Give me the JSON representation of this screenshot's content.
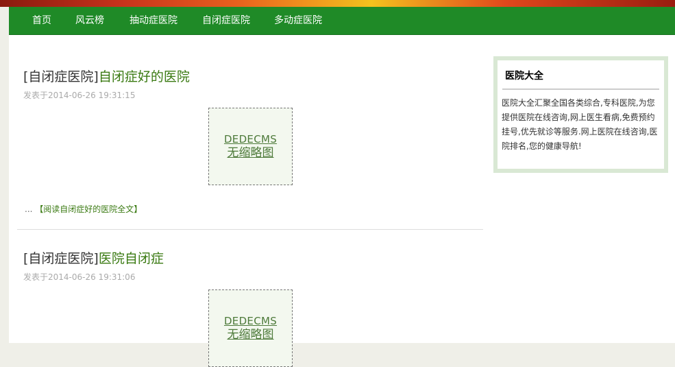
{
  "nav": {
    "items": [
      "首页",
      "风云榜",
      "抽动症医院",
      "自闭症医院",
      "多动症医院"
    ]
  },
  "articles": [
    {
      "category": "[自闭症医院]",
      "title": "自闭症好的医院",
      "meta": "发表于2014-06-26 19:31:15",
      "thumb_line1": "DEDECMS",
      "thumb_line2": "无缩略图",
      "ellipsis": "...",
      "read_more": "【阅读自闭症好的医院全文】"
    },
    {
      "category": "[自闭症医院]",
      "title": "医院自闭症",
      "meta": "发表于2014-06-26 19:31:06",
      "thumb_line1": "DEDECMS",
      "thumb_line2": "无缩略图"
    }
  ],
  "sidebar": {
    "title": "医院大全",
    "description": "医院大全汇聚全国各类综合,专科医院,为您提供医院在线咨询,网上医生看病,免费预约挂号,优先就诊等服务.网上医院在线咨询,医院排名,您的健康导航!"
  },
  "colors": {
    "nav_bg": "#1f8a27",
    "link_green": "#3a7a12",
    "sidebar_border": "#d9e8d4"
  }
}
